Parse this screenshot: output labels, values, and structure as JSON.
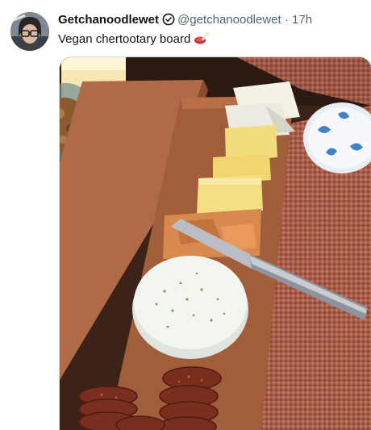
{
  "tweet": {
    "display_name": "Getchanoodlewet",
    "handle": "@getchanoodlewet",
    "separator": "·",
    "timestamp": "17h",
    "text": "Vegan chertootary board",
    "emoji_icon": "meat-on-bone-icon",
    "badge_icon": "verified-badge-icon"
  },
  "colors": {
    "text_primary": "#0f1419",
    "text_secondary": "#536471",
    "border": "#cfd9de"
  }
}
